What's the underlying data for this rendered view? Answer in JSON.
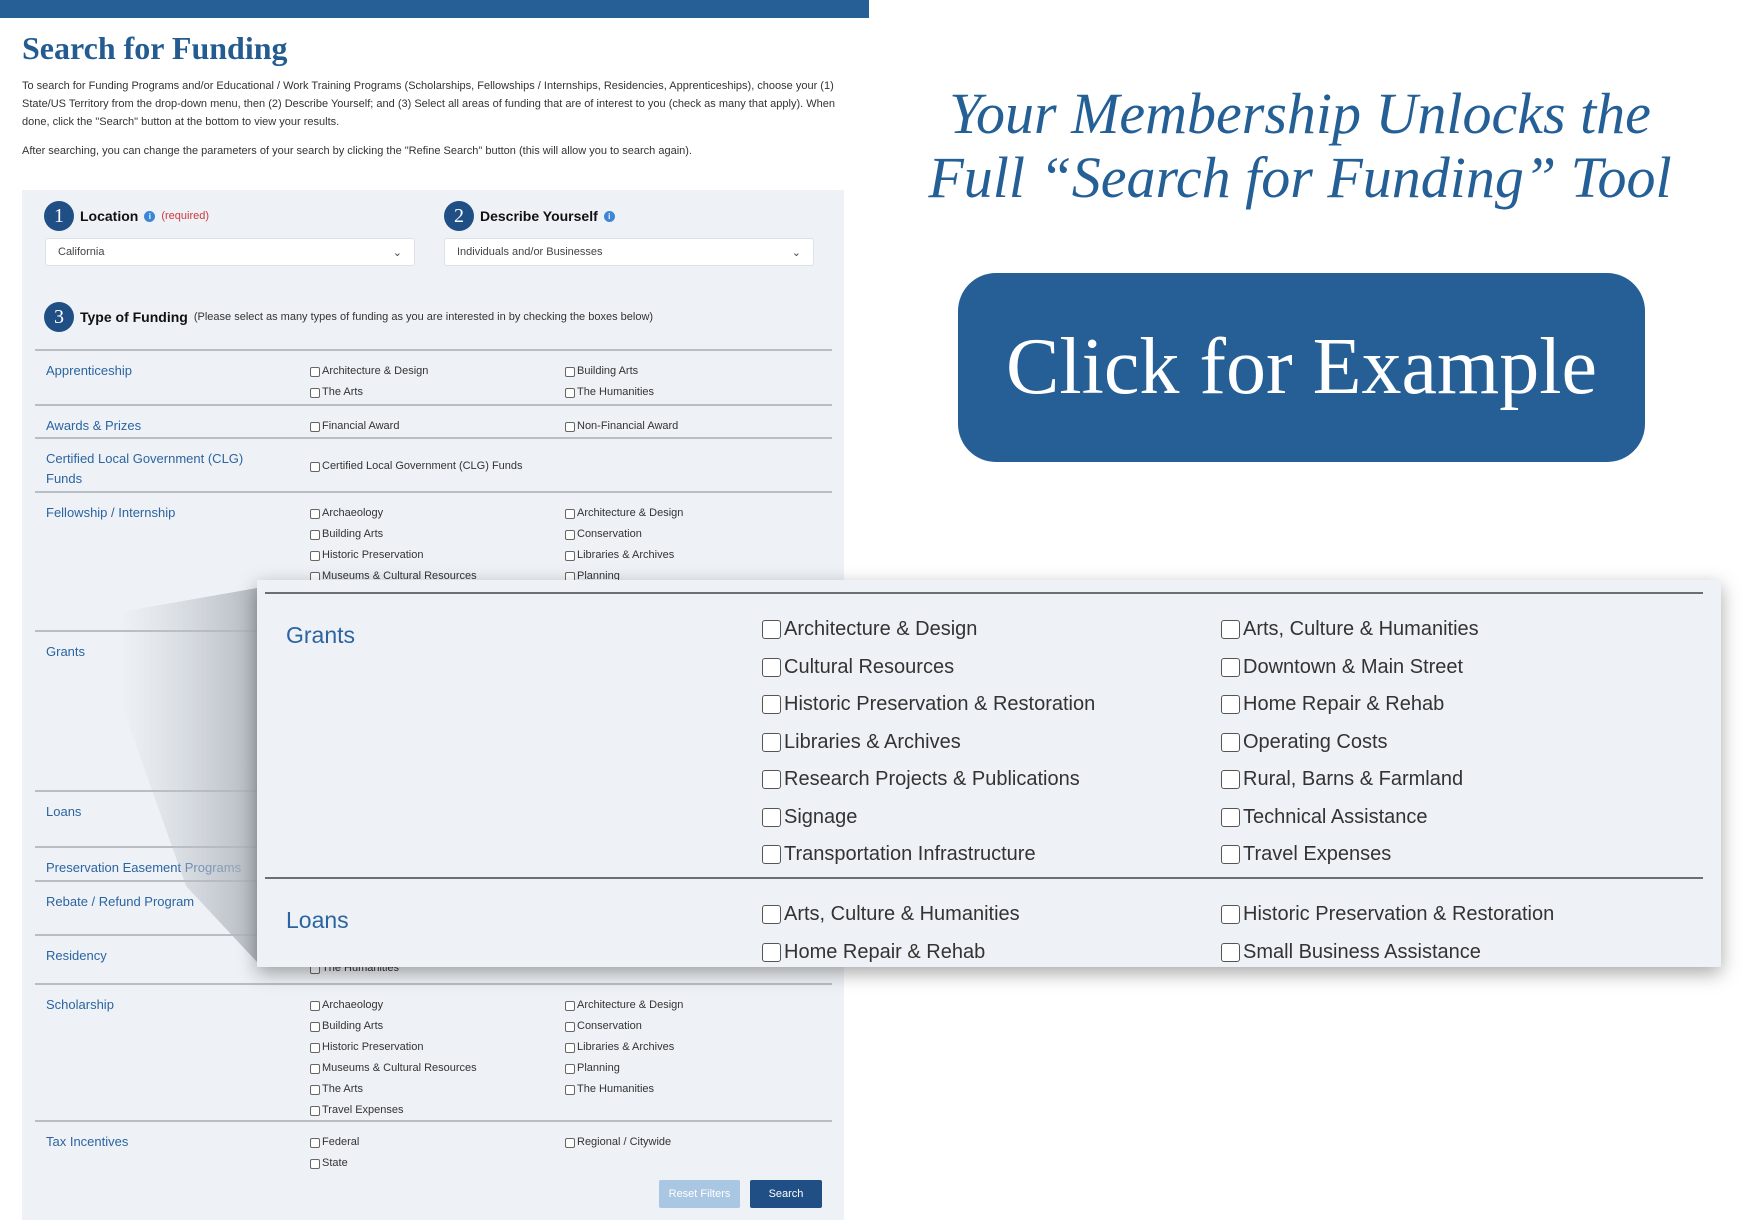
{
  "page": {
    "title": "Search for Funding",
    "intro": "To search for Funding Programs and/or Educational / Work Training Programs (Scholarships, Fellowships / Internships, Residencies, Apprenticeships), choose your (1) State/US Territory from the drop-down menu, then (2) Describe Yourself; and (3) Select all areas of funding that are of interest to you (check as many that apply). When done, click the \"Search\" button at the bottom to view your results.",
    "intro2": "After searching, you can change the parameters of your search by clicking the \"Refine Search\" button (this will allow you to search again)."
  },
  "steps": {
    "location": {
      "number": "1",
      "label": "Location",
      "required": "(required)",
      "value": "California"
    },
    "describe": {
      "number": "2",
      "label": "Describe Yourself",
      "value": "Individuals and/or Businesses"
    },
    "type": {
      "number": "3",
      "label": "Type of Funding",
      "hint": "(Please select as many types of funding as you are interested in by checking the boxes below)"
    }
  },
  "funding_rows": [
    {
      "label": "Apprenticeship",
      "col1": [
        "Architecture & Design",
        "The Arts"
      ],
      "col2": [
        "Building Arts",
        "The Humanities"
      ]
    },
    {
      "label": "Awards & Prizes",
      "col1": [
        "Financial Award"
      ],
      "col2": [
        "Non-Financial Award"
      ]
    },
    {
      "label": "Certified Local Government (CLG) Funds",
      "col1": [
        "Certified Local Government (CLG) Funds"
      ],
      "col2": []
    },
    {
      "label": "Fellowship / Internship",
      "col1": [
        "Archaeology",
        "Building Arts",
        "Historic Preservation",
        "Museums & Cultural Resources"
      ],
      "col2": [
        "Architecture & Design",
        "Conservation",
        "Libraries & Archives",
        "Planning"
      ]
    },
    {
      "label": "Grants",
      "col1": [],
      "col2": []
    },
    {
      "label": "Loans",
      "col1": [],
      "col2": []
    },
    {
      "label": "Preservation Easement Programs",
      "col1": [],
      "col2": []
    },
    {
      "label": "Rebate / Refund Program",
      "col1": [],
      "col2": []
    },
    {
      "label": "Residency",
      "col1": [
        "The Humanities"
      ],
      "col2": []
    },
    {
      "label": "Scholarship",
      "col1": [
        "Archaeology",
        "Building Arts",
        "Historic Preservation",
        "Museums & Cultural Resources",
        "The Arts",
        "Travel Expenses"
      ],
      "col2": [
        "Architecture & Design",
        "Conservation",
        "Libraries & Archives",
        "Planning",
        "The Humanities"
      ]
    },
    {
      "label": "Tax Incentives",
      "col1": [
        "Federal",
        "State"
      ],
      "col2": [
        "Regional / Citywide"
      ]
    }
  ],
  "buttons": {
    "reset": "Reset Filters",
    "search": "Search"
  },
  "zoom_popup": [
    {
      "label": "Grants",
      "col1": [
        "Architecture & Design",
        "Cultural Resources",
        "Historic Preservation & Restoration",
        "Libraries & Archives",
        "Research Projects & Publications",
        "Signage",
        "Transportation Infrastructure"
      ],
      "col2": [
        "Arts, Culture & Humanities",
        "Downtown & Main Street",
        "Home Repair & Rehab",
        "Operating Costs",
        "Rural, Barns & Farmland",
        "Technical Assistance",
        "Travel Expenses"
      ]
    },
    {
      "label": "Loans",
      "col1": [
        "Arts, Culture & Humanities",
        "Home Repair & Rehab"
      ],
      "col2": [
        "Historic Preservation & Restoration",
        "Small Business Assistance"
      ]
    }
  ],
  "promo": {
    "headline_line1": "Your Membership Unlocks the",
    "headline_line2": "Full “Search for Funding” Tool",
    "cta": "Click for Example"
  },
  "colors": {
    "brand_blue": "#255f96",
    "link_blue": "#2b64a0",
    "panel_bg": "#eef2f6",
    "required_red": "#d0383d"
  }
}
